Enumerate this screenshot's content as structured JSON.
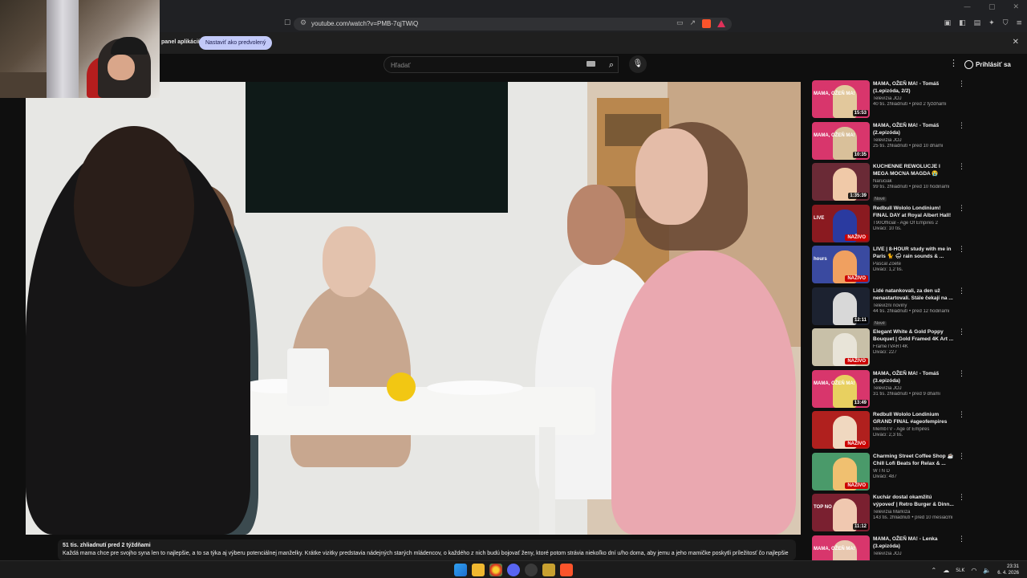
{
  "browser": {
    "url": "youtube.com/watch?v=PMB-7qjTWiQ",
    "infobar_text": "panel aplikácií",
    "infobar_button": "Nastaviť ako predvolený"
  },
  "yt_header": {
    "search_placeholder": "Hľadať",
    "sign_in_label": "Prihlásiť sa"
  },
  "description": {
    "stats": "51 tis. zhliadnutí  pred 2 týždňami",
    "text": "Každá mama chce pre svojho syna len to najlepšie, a to sa týka aj výberu potenciálnej manželky. Krátke vizitky predstavia nádejných starých mládencov, o každého z nich budú bojovať ženy, ktoré potom strávia niekoľko dní u/ho doma, aby jemu a jeho mamičke poskytli príležitosť čo najlepšie"
  },
  "recommendations": [
    {
      "title": "MAMA, OŽEŇ MA! - Tomáš (1.epizóda, 2/2)",
      "channel": "Televízia JOJ",
      "stats": "40 tis. zhliadnutí • pred 2 týždňami",
      "duration": "15:53",
      "thumb_tag": "MAMA, OŽEŇ MA!",
      "thumb_color": "#d8366c",
      "fig_color": "#e2c89c"
    },
    {
      "title": "MAMA, OŽEŇ MA! - Tomáš (2.epizóda)",
      "channel": "Televízia JOJ",
      "stats": "25 tis. zhliadnutí • pred 10 dňami",
      "duration": "10:35",
      "thumb_tag": "MAMA, OŽEŇ MA!",
      "thumb_color": "#d8366c",
      "fig_color": "#d9c09a"
    },
    {
      "title": "KUCHENNE REWOLUCJE I MEGA MOCNA MAGDA 😭",
      "channel": "Naruciak",
      "stats": "99 tis. zhliadnutí • pred 10 hodinami",
      "duration": "1:35:39",
      "badge": "Nové",
      "thumb_color": "#6a2a36",
      "fig_color": "#f0c9a8"
    },
    {
      "title": "Redbull Wololo Londinium! FINAL DAY at Royal Albert Hall!",
      "channel": "T90Official - Age Of Empires 2",
      "stats": "Diváci: 10 tis.",
      "live": "NAŽIVO",
      "thumb_tag": "LIVE",
      "thumb_color": "#8a1a20",
      "fig_color": "#2a3aa0"
    },
    {
      "title": "LIVE | 8-HOUR study with me in Paris 🐈 🌧 rain sounds & ...",
      "channel": "Pascal Zoete",
      "stats": "Diváci: 1,2 tis.",
      "live": "NAŽIVO",
      "thumb_tag": "hours",
      "thumb_color": "#3a4aa0",
      "fig_color": "#f0a060"
    },
    {
      "title": "Lidé natankovali, za den už nenastartovali. Stále čekají na ...",
      "channel": "Televizní noviny",
      "stats": "44 tis. zhliadnutí • pred 12 hodinami",
      "duration": "12:11",
      "badge": "Nové",
      "thumb_color": "#1c2230",
      "fig_color": "#d8d8d8"
    },
    {
      "title": "Elegant White & Gold Poppy Bouquet | Gold Framed 4K Art ...",
      "channel": "FrameTVART4K",
      "stats": "Diváci: 227",
      "live": "NAŽIVO",
      "thumb_color": "#c8c0a8",
      "fig_color": "#e8e4d8"
    },
    {
      "title": "MAMA, OŽEŇ MA! - Tomáš (3.epizóda)",
      "channel": "Televízia JOJ",
      "stats": "31 tis. zhliadnutí • pred 9 dňami",
      "duration": "13:49",
      "thumb_tag": "MAMA, OŽEŇ MA!",
      "thumb_color": "#d8366c",
      "fig_color": "#e8d060"
    },
    {
      "title": "Redbull Wololo Londinium GRAND FINAL #ageofempires",
      "channel": "MembTV - Age of Empires",
      "stats": "Diváci: 2,3 tis.",
      "live": "NAŽIVO",
      "thumb_color": "#b0201e",
      "fig_color": "#f0d8c0"
    },
    {
      "title": "Charming Street Coffee Shop ☕ Chill Lofi Beats for Relax & ...",
      "channel": "W I N D",
      "stats": "Diváci: 487",
      "live": "NAŽIVO",
      "thumb_color": "#4a9a6a",
      "fig_color": "#f0c070"
    },
    {
      "title": "Kuchár dostal okamžitú výpoveď | Retro Burger & Dinn...",
      "channel": "Televízia Markíza",
      "stats": "143 tis. zhliadnutí • pred 10 mesiacmi",
      "duration": "11:12",
      "thumb_tag": "TOP NO",
      "thumb_color": "#7a2030",
      "fig_color": "#f0c8b0"
    },
    {
      "title": "MAMA, OŽEŇ MA! - Lenka (3.epizóda)",
      "channel": "Televízia JOJ",
      "stats": "",
      "thumb_tag": "MAMA, OŽEŇ MA!",
      "thumb_color": "#d8366c",
      "fig_color": "#e8c8b0"
    }
  ],
  "taskbar": {
    "language": "SLK",
    "time": "23:31",
    "date": "6. 4. 2026"
  }
}
